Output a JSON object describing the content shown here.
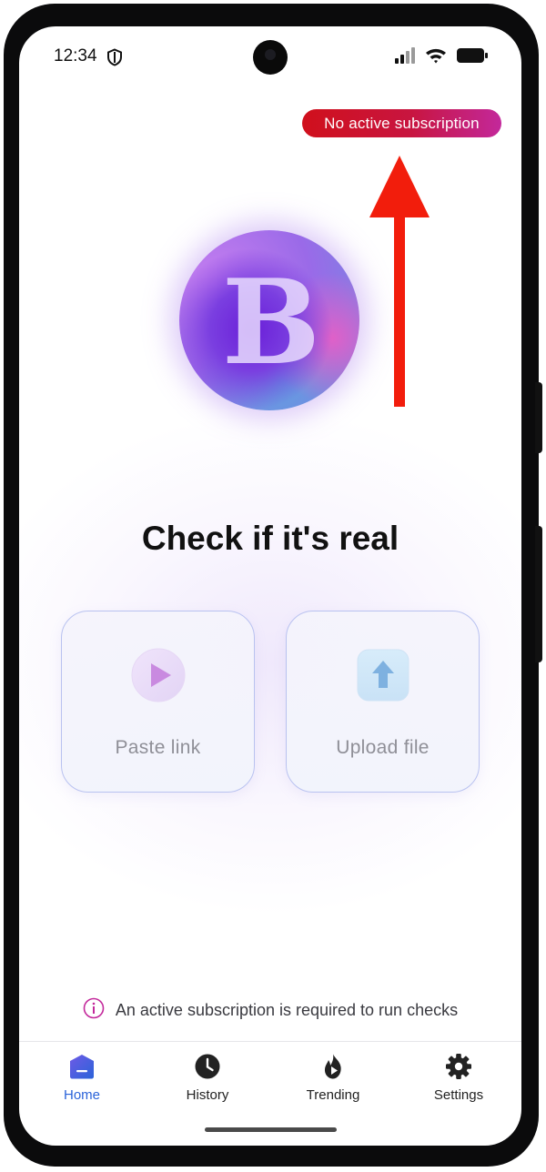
{
  "status_bar": {
    "time": "12:34"
  },
  "badge": {
    "label": "No active subscription"
  },
  "logo": {
    "letter": "B"
  },
  "headline": "Check if it's real",
  "actions": [
    {
      "label": "Paste link",
      "icon": "play-icon"
    },
    {
      "label": "Upload file",
      "icon": "upload-arrow-icon"
    }
  ],
  "notice": {
    "text": "An active subscription is required to run checks",
    "icon": "info-icon"
  },
  "nav": [
    {
      "label": "Home",
      "icon": "home-icon",
      "active": true
    },
    {
      "label": "History",
      "icon": "clock-icon",
      "active": false
    },
    {
      "label": "Trending",
      "icon": "flame-icon",
      "active": false
    },
    {
      "label": "Settings",
      "icon": "gear-icon",
      "active": false
    }
  ],
  "colors": {
    "accent": "#2b63d9",
    "badge_start": "#d0101c",
    "badge_end": "#c3289b",
    "annotation_arrow": "#f21d0c",
    "info_icon": "#c3289b"
  }
}
